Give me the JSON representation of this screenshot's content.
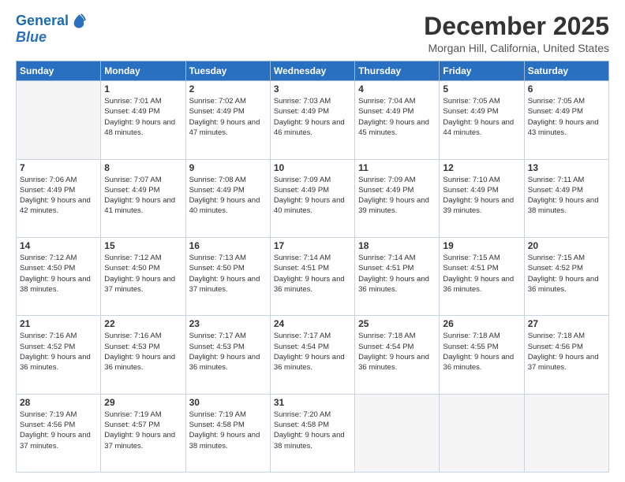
{
  "header": {
    "logo_line1": "General",
    "logo_line2": "Blue",
    "month": "December 2025",
    "location": "Morgan Hill, California, United States"
  },
  "weekdays": [
    "Sunday",
    "Monday",
    "Tuesday",
    "Wednesday",
    "Thursday",
    "Friday",
    "Saturday"
  ],
  "weeks": [
    [
      {
        "day": "",
        "sunrise": "",
        "sunset": "",
        "daylight": ""
      },
      {
        "day": "1",
        "sunrise": "7:01 AM",
        "sunset": "4:49 PM",
        "daylight": "9 hours and 48 minutes."
      },
      {
        "day": "2",
        "sunrise": "7:02 AM",
        "sunset": "4:49 PM",
        "daylight": "9 hours and 47 minutes."
      },
      {
        "day": "3",
        "sunrise": "7:03 AM",
        "sunset": "4:49 PM",
        "daylight": "9 hours and 46 minutes."
      },
      {
        "day": "4",
        "sunrise": "7:04 AM",
        "sunset": "4:49 PM",
        "daylight": "9 hours and 45 minutes."
      },
      {
        "day": "5",
        "sunrise": "7:05 AM",
        "sunset": "4:49 PM",
        "daylight": "9 hours and 44 minutes."
      },
      {
        "day": "6",
        "sunrise": "7:05 AM",
        "sunset": "4:49 PM",
        "daylight": "9 hours and 43 minutes."
      }
    ],
    [
      {
        "day": "7",
        "sunrise": "7:06 AM",
        "sunset": "4:49 PM",
        "daylight": "9 hours and 42 minutes."
      },
      {
        "day": "8",
        "sunrise": "7:07 AM",
        "sunset": "4:49 PM",
        "daylight": "9 hours and 41 minutes."
      },
      {
        "day": "9",
        "sunrise": "7:08 AM",
        "sunset": "4:49 PM",
        "daylight": "9 hours and 40 minutes."
      },
      {
        "day": "10",
        "sunrise": "7:09 AM",
        "sunset": "4:49 PM",
        "daylight": "9 hours and 40 minutes."
      },
      {
        "day": "11",
        "sunrise": "7:09 AM",
        "sunset": "4:49 PM",
        "daylight": "9 hours and 39 minutes."
      },
      {
        "day": "12",
        "sunrise": "7:10 AM",
        "sunset": "4:49 PM",
        "daylight": "9 hours and 39 minutes."
      },
      {
        "day": "13",
        "sunrise": "7:11 AM",
        "sunset": "4:49 PM",
        "daylight": "9 hours and 38 minutes."
      }
    ],
    [
      {
        "day": "14",
        "sunrise": "7:12 AM",
        "sunset": "4:50 PM",
        "daylight": "9 hours and 38 minutes."
      },
      {
        "day": "15",
        "sunrise": "7:12 AM",
        "sunset": "4:50 PM",
        "daylight": "9 hours and 37 minutes."
      },
      {
        "day": "16",
        "sunrise": "7:13 AM",
        "sunset": "4:50 PM",
        "daylight": "9 hours and 37 minutes."
      },
      {
        "day": "17",
        "sunrise": "7:14 AM",
        "sunset": "4:51 PM",
        "daylight": "9 hours and 36 minutes."
      },
      {
        "day": "18",
        "sunrise": "7:14 AM",
        "sunset": "4:51 PM",
        "daylight": "9 hours and 36 minutes."
      },
      {
        "day": "19",
        "sunrise": "7:15 AM",
        "sunset": "4:51 PM",
        "daylight": "9 hours and 36 minutes."
      },
      {
        "day": "20",
        "sunrise": "7:15 AM",
        "sunset": "4:52 PM",
        "daylight": "9 hours and 36 minutes."
      }
    ],
    [
      {
        "day": "21",
        "sunrise": "7:16 AM",
        "sunset": "4:52 PM",
        "daylight": "9 hours and 36 minutes."
      },
      {
        "day": "22",
        "sunrise": "7:16 AM",
        "sunset": "4:53 PM",
        "daylight": "9 hours and 36 minutes."
      },
      {
        "day": "23",
        "sunrise": "7:17 AM",
        "sunset": "4:53 PM",
        "daylight": "9 hours and 36 minutes."
      },
      {
        "day": "24",
        "sunrise": "7:17 AM",
        "sunset": "4:54 PM",
        "daylight": "9 hours and 36 minutes."
      },
      {
        "day": "25",
        "sunrise": "7:18 AM",
        "sunset": "4:54 PM",
        "daylight": "9 hours and 36 minutes."
      },
      {
        "day": "26",
        "sunrise": "7:18 AM",
        "sunset": "4:55 PM",
        "daylight": "9 hours and 36 minutes."
      },
      {
        "day": "27",
        "sunrise": "7:18 AM",
        "sunset": "4:56 PM",
        "daylight": "9 hours and 37 minutes."
      }
    ],
    [
      {
        "day": "28",
        "sunrise": "7:19 AM",
        "sunset": "4:56 PM",
        "daylight": "9 hours and 37 minutes."
      },
      {
        "day": "29",
        "sunrise": "7:19 AM",
        "sunset": "4:57 PM",
        "daylight": "9 hours and 37 minutes."
      },
      {
        "day": "30",
        "sunrise": "7:19 AM",
        "sunset": "4:58 PM",
        "daylight": "9 hours and 38 minutes."
      },
      {
        "day": "31",
        "sunrise": "7:20 AM",
        "sunset": "4:58 PM",
        "daylight": "9 hours and 38 minutes."
      },
      {
        "day": "",
        "sunrise": "",
        "sunset": "",
        "daylight": ""
      },
      {
        "day": "",
        "sunrise": "",
        "sunset": "",
        "daylight": ""
      },
      {
        "day": "",
        "sunrise": "",
        "sunset": "",
        "daylight": ""
      }
    ]
  ],
  "labels": {
    "sunrise": "Sunrise: ",
    "sunset": "Sunset: ",
    "daylight": "Daylight: "
  }
}
